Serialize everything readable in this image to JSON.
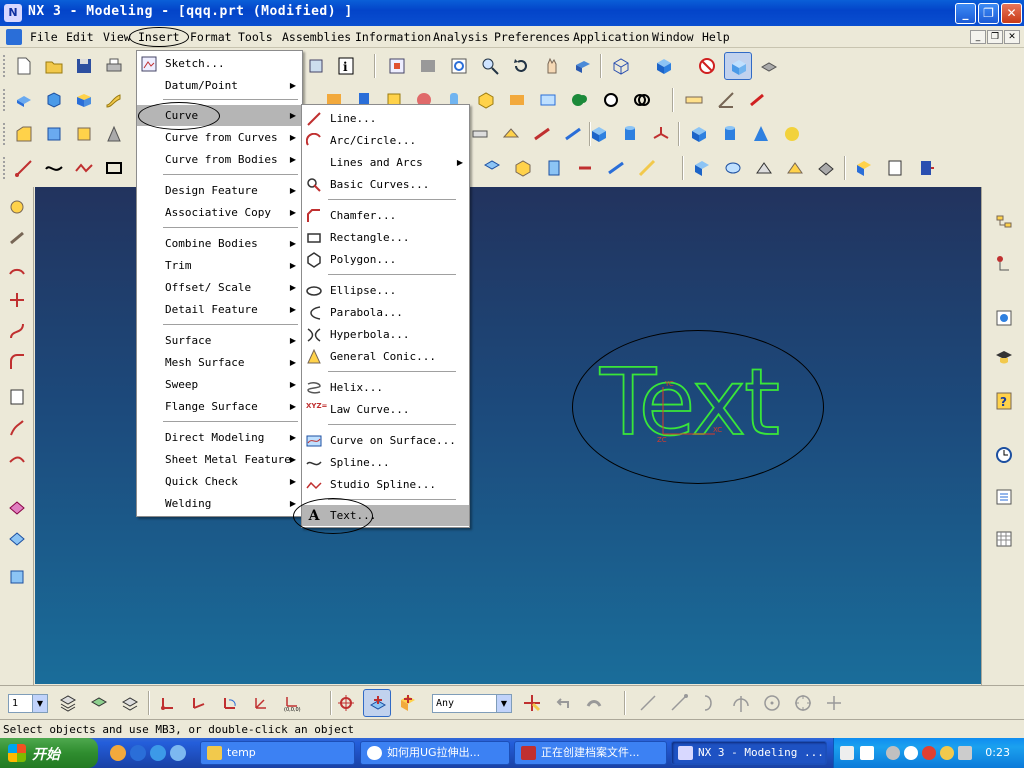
{
  "window": {
    "title": "NX 3 - Modeling - [qqq.prt (Modified) ]",
    "minimize_glyph": "_",
    "restore_glyph": "❐",
    "close_glyph": "✕"
  },
  "menubar": {
    "items": [
      "File",
      "Edit",
      "View",
      "Insert",
      "Format",
      "Tools",
      "Assemblies",
      "Information",
      "Analysis",
      "Preferences",
      "Application",
      "Window",
      "Help"
    ],
    "active": "Insert",
    "mdi_controls": [
      "_",
      "❐",
      "✕"
    ]
  },
  "insert_menu": {
    "items": [
      {
        "label": "Sketch...",
        "submenu": false,
        "icon": "sketch-icon"
      },
      {
        "label": "Datum/Point",
        "submenu": true
      },
      {
        "label": "Curve",
        "submenu": true,
        "highlighted": true
      },
      {
        "label": "Curve from Curves",
        "submenu": true
      },
      {
        "label": "Curve from Bodies",
        "submenu": true
      },
      {
        "label": "Design Feature",
        "submenu": true
      },
      {
        "label": "Associative Copy",
        "submenu": true
      },
      {
        "label": "Combine Bodies",
        "submenu": true
      },
      {
        "label": "Trim",
        "submenu": true
      },
      {
        "label": "Offset/ Scale",
        "submenu": true
      },
      {
        "label": "Detail Feature",
        "submenu": true
      },
      {
        "label": "Surface",
        "submenu": true
      },
      {
        "label": "Mesh Surface",
        "submenu": true
      },
      {
        "label": "Sweep",
        "submenu": true
      },
      {
        "label": "Flange Surface",
        "submenu": true
      },
      {
        "label": "Direct Modeling",
        "submenu": true
      },
      {
        "label": "Sheet Metal Feature",
        "submenu": true
      },
      {
        "label": "Quick Check",
        "submenu": true
      },
      {
        "label": "Welding",
        "submenu": true
      }
    ]
  },
  "curve_menu": {
    "items": [
      {
        "label": "Line...",
        "icon": "line-icon"
      },
      {
        "label": "Arc/Circle...",
        "icon": "arc-icon"
      },
      {
        "label": "Lines and Arcs",
        "submenu": true
      },
      {
        "label": "Basic Curves...",
        "icon": "basic-curves-icon"
      },
      {
        "label": "Chamfer...",
        "icon": "chamfer-icon"
      },
      {
        "label": "Rectangle...",
        "icon": "rectangle-icon"
      },
      {
        "label": "Polygon...",
        "icon": "polygon-icon"
      },
      {
        "label": "Ellipse...",
        "icon": "ellipse-icon"
      },
      {
        "label": "Parabola...",
        "icon": "parabola-icon"
      },
      {
        "label": "Hyperbola...",
        "icon": "hyperbola-icon"
      },
      {
        "label": "General Conic...",
        "icon": "conic-icon"
      },
      {
        "label": "Helix...",
        "icon": "helix-icon"
      },
      {
        "label": "Law Curve...",
        "icon": "law-curve-icon",
        "icon_text": "XYZ="
      },
      {
        "label": "Curve on Surface...",
        "icon": "curve-on-surface-icon"
      },
      {
        "label": "Spline...",
        "icon": "spline-icon"
      },
      {
        "label": "Studio Spline...",
        "icon": "studio-spline-icon"
      },
      {
        "label": "Text...",
        "icon": "text-icon",
        "icon_text": "A",
        "highlighted": true
      }
    ]
  },
  "graphics": {
    "model_text": "Text",
    "axis_labels": {
      "y": "YC",
      "z": "ZC",
      "x": "XC"
    }
  },
  "bottom_toolbar": {
    "layer_value": "1",
    "filter_value": "Any"
  },
  "status": {
    "message": "Select objects and use MB3, or double-click an object"
  },
  "taskbar": {
    "start_label": "开始",
    "buttons": [
      {
        "label": "temp",
        "active": false
      },
      {
        "label": "如何用UG拉伸出...",
        "active": false
      },
      {
        "label": "正在创建档案文件...",
        "active": false
      },
      {
        "label": "NX 3 - Modeling ...",
        "active": true
      }
    ],
    "clock": "0:23"
  },
  "colors": {
    "accent": "#316ac5",
    "model_text": "#39e639",
    "axis": "#d83a2a"
  }
}
